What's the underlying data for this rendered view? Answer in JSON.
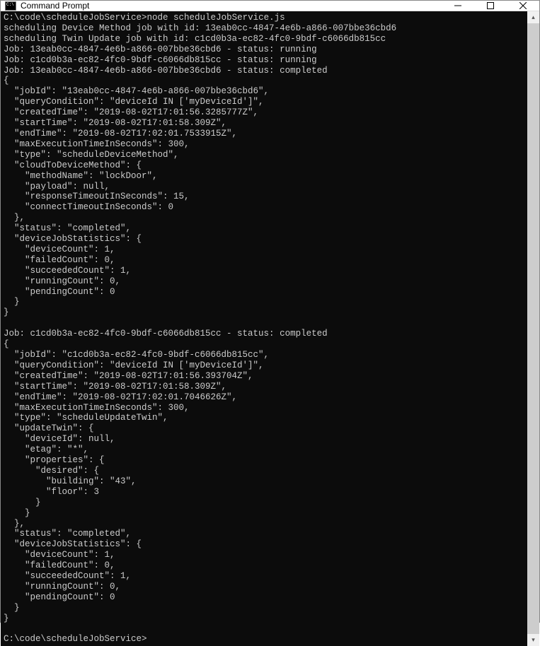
{
  "window": {
    "title": "Command Prompt"
  },
  "terminal": {
    "prompt1": "C:\\code\\scheduleJobService>",
    "cmd": "node scheduleJobService.js",
    "l1": "scheduling Device Method job with id: 13eab0cc-4847-4e6b-a866-007bbe36cbd6",
    "l2": "scheduling Twin Update job with id: c1cd0b3a-ec82-4fc0-9bdf-c6066db815cc",
    "l3": "Job: 13eab0cc-4847-4e6b-a866-007bbe36cbd6 - status: running",
    "l4": "Job: c1cd0b3a-ec82-4fc0-9bdf-c6066db815cc - status: running",
    "l5": "Job: 13eab0cc-4847-4e6b-a866-007bbe36cbd6 - status: completed",
    "json1": "{\n  \"jobId\": \"13eab0cc-4847-4e6b-a866-007bbe36cbd6\",\n  \"queryCondition\": \"deviceId IN ['myDeviceId']\",\n  \"createdTime\": \"2019-08-02T17:01:56.3285777Z\",\n  \"startTime\": \"2019-08-02T17:01:58.309Z\",\n  \"endTime\": \"2019-08-02T17:02:01.7533915Z\",\n  \"maxExecutionTimeInSeconds\": 300,\n  \"type\": \"scheduleDeviceMethod\",\n  \"cloudToDeviceMethod\": {\n    \"methodName\": \"lockDoor\",\n    \"payload\": null,\n    \"responseTimeoutInSeconds\": 15,\n    \"connectTimeoutInSeconds\": 0\n  },\n  \"status\": \"completed\",\n  \"deviceJobStatistics\": {\n    \"deviceCount\": 1,\n    \"failedCount\": 0,\n    \"succeededCount\": 1,\n    \"runningCount\": 0,\n    \"pendingCount\": 0\n  }\n}",
    "l6": "Job: c1cd0b3a-ec82-4fc0-9bdf-c6066db815cc - status: completed",
    "json2": "{\n  \"jobId\": \"c1cd0b3a-ec82-4fc0-9bdf-c6066db815cc\",\n  \"queryCondition\": \"deviceId IN ['myDeviceId']\",\n  \"createdTime\": \"2019-08-02T17:01:56.393704Z\",\n  \"startTime\": \"2019-08-02T17:01:58.309Z\",\n  \"endTime\": \"2019-08-02T17:02:01.7046626Z\",\n  \"maxExecutionTimeInSeconds\": 300,\n  \"type\": \"scheduleUpdateTwin\",\n  \"updateTwin\": {\n    \"deviceId\": null,\n    \"etag\": \"*\",\n    \"properties\": {\n      \"desired\": {\n        \"building\": \"43\",\n        \"floor\": 3\n      }\n    }\n  },\n  \"status\": \"completed\",\n  \"deviceJobStatistics\": {\n    \"deviceCount\": 1,\n    \"failedCount\": 0,\n    \"succeededCount\": 1,\n    \"runningCount\": 0,\n    \"pendingCount\": 0\n  }\n}",
    "prompt2": "C:\\code\\scheduleJobService>"
  },
  "colors": {
    "bg": "#0c0c0c",
    "fg": "#cccccc"
  }
}
